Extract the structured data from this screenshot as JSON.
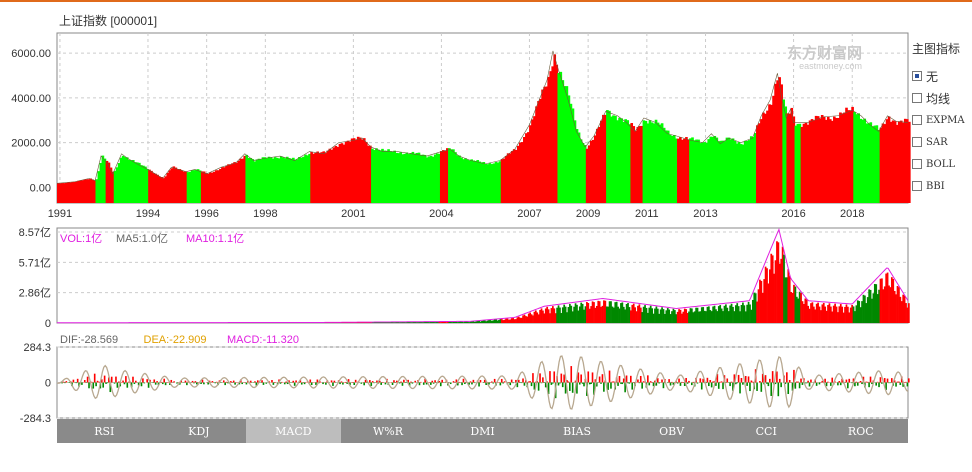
{
  "title": "上证指数 [000001]",
  "logo": {
    "name": "东方财富网",
    "sub": "eastmoney.com"
  },
  "side_panel": {
    "header": "主图指标",
    "options": [
      {
        "label": "无",
        "checked": true
      },
      {
        "label": "均线",
        "checked": false
      },
      {
        "label": "EXPMA",
        "checked": false
      },
      {
        "label": "SAR",
        "checked": false
      },
      {
        "label": "BOLL",
        "checked": false
      },
      {
        "label": "BBI",
        "checked": false
      }
    ]
  },
  "tabs": [
    {
      "label": "RSI",
      "active": false
    },
    {
      "label": "KDJ",
      "active": false
    },
    {
      "label": "MACD",
      "active": true
    },
    {
      "label": "W%R",
      "active": false
    },
    {
      "label": "DMI",
      "active": false
    },
    {
      "label": "BIAS",
      "active": false
    },
    {
      "label": "OBV",
      "active": false
    },
    {
      "label": "CCI",
      "active": false
    },
    {
      "label": "ROC",
      "active": false
    }
  ],
  "colors": {
    "up": "#ff0000",
    "down": "#00ff00",
    "grid": "#cccccc",
    "vol": "#e020e0",
    "dea": "#e0a000",
    "dif": "#666666",
    "diffline": "#b8a890"
  },
  "chart_data": [
    {
      "type": "area",
      "series_name": "price",
      "x_ticks": [
        "1991",
        "1994",
        "1996",
        "1998",
        "2001",
        "2004",
        "2007",
        "2009",
        "2011",
        "2013",
        "2016",
        "2018"
      ],
      "y_ticks": [
        "0.00",
        "2000.00",
        "4000.00",
        "6000.00"
      ],
      "ylim": [
        -700,
        6900
      ],
      "xlim": [
        1990.9,
        2019.9
      ],
      "points": [
        [
          1990.9,
          180
        ],
        [
          1991.5,
          250
        ],
        [
          1992.0,
          400
        ],
        [
          1992.2,
          300
        ],
        [
          1992.4,
          1400
        ],
        [
          1992.6,
          1100
        ],
        [
          1992.8,
          600
        ],
        [
          1993.1,
          1500
        ],
        [
          1993.3,
          1300
        ],
        [
          1993.7,
          1000
        ],
        [
          1994.0,
          800
        ],
        [
          1994.5,
          400
        ],
        [
          1994.8,
          900
        ],
        [
          1995.3,
          700
        ],
        [
          1995.6,
          800
        ],
        [
          1996.0,
          600
        ],
        [
          1996.5,
          900
        ],
        [
          1997.0,
          1100
        ],
        [
          1997.3,
          1500
        ],
        [
          1997.6,
          1200
        ],
        [
          1998.0,
          1300
        ],
        [
          1998.5,
          1400
        ],
        [
          1999.0,
          1200
        ],
        [
          1999.5,
          1600
        ],
        [
          2000.0,
          1500
        ],
        [
          2000.5,
          2000
        ],
        [
          2001.0,
          2100
        ],
        [
          2001.3,
          2200
        ],
        [
          2001.6,
          1800
        ],
        [
          2002.0,
          1600
        ],
        [
          2002.5,
          1600
        ],
        [
          2003.0,
          1500
        ],
        [
          2003.5,
          1400
        ],
        [
          2004.0,
          1600
        ],
        [
          2004.3,
          1700
        ],
        [
          2004.6,
          1400
        ],
        [
          2005.0,
          1200
        ],
        [
          2005.5,
          1050
        ],
        [
          2006.0,
          1200
        ],
        [
          2006.5,
          1700
        ],
        [
          2007.0,
          2800
        ],
        [
          2007.3,
          3800
        ],
        [
          2007.6,
          4800
        ],
        [
          2007.8,
          6100
        ],
        [
          2008.0,
          5200
        ],
        [
          2008.3,
          4000
        ],
        [
          2008.6,
          2500
        ],
        [
          2008.9,
          1800
        ],
        [
          2009.2,
          2300
        ],
        [
          2009.6,
          3400
        ],
        [
          2010.0,
          3200
        ],
        [
          2010.3,
          2900
        ],
        [
          2010.6,
          2500
        ],
        [
          2010.9,
          3100
        ],
        [
          2011.3,
          2900
        ],
        [
          2011.7,
          2400
        ],
        [
          2012.0,
          2300
        ],
        [
          2012.5,
          2100
        ],
        [
          2012.9,
          2000
        ],
        [
          2013.2,
          2400
        ],
        [
          2013.5,
          1950
        ],
        [
          2013.8,
          2200
        ],
        [
          2014.2,
          2000
        ],
        [
          2014.6,
          2200
        ],
        [
          2014.9,
          3200
        ],
        [
          2015.2,
          3900
        ],
        [
          2015.45,
          5100
        ],
        [
          2015.6,
          4000
        ],
        [
          2015.75,
          3100
        ],
        [
          2015.9,
          3500
        ],
        [
          2016.0,
          2900
        ],
        [
          2016.5,
          2900
        ],
        [
          2017.0,
          3150
        ],
        [
          2017.5,
          3200
        ],
        [
          2018.0,
          3450
        ],
        [
          2018.3,
          3200
        ],
        [
          2018.6,
          2800
        ],
        [
          2018.9,
          2500
        ],
        [
          2019.2,
          3200
        ],
        [
          2019.5,
          2950
        ],
        [
          2019.9,
          2900
        ]
      ],
      "color_segments": [
        [
          1990.9,
          1992.2,
          "up"
        ],
        [
          1992.2,
          1992.5,
          "down"
        ],
        [
          1992.5,
          1992.8,
          "up"
        ],
        [
          1992.8,
          1994.0,
          "down"
        ],
        [
          1994.0,
          1995.3,
          "up"
        ],
        [
          1995.3,
          1995.8,
          "down"
        ],
        [
          1995.8,
          1997.3,
          "up"
        ],
        [
          1997.3,
          1999.5,
          "down"
        ],
        [
          1999.5,
          2001.6,
          "up"
        ],
        [
          2001.6,
          2003.9,
          "down"
        ],
        [
          2003.9,
          2004.2,
          "up"
        ],
        [
          2004.2,
          2006.0,
          "down"
        ],
        [
          2006.0,
          2007.9,
          "up"
        ],
        [
          2007.9,
          2008.9,
          "down"
        ],
        [
          2008.9,
          2009.6,
          "up"
        ],
        [
          2009.6,
          2010.4,
          "down"
        ],
        [
          2010.4,
          2010.8,
          "up"
        ],
        [
          2010.8,
          2012.0,
          "down"
        ],
        [
          2012.0,
          2012.4,
          "up"
        ],
        [
          2012.4,
          2014.7,
          "down"
        ],
        [
          2014.7,
          2015.6,
          "up"
        ],
        [
          2015.6,
          2015.75,
          "down"
        ],
        [
          2015.75,
          2016.0,
          "up"
        ],
        [
          2016.0,
          2016.2,
          "down"
        ],
        [
          2016.2,
          2018.0,
          "up"
        ],
        [
          2018.0,
          2018.9,
          "down"
        ],
        [
          2018.9,
          2019.9,
          "up"
        ]
      ]
    },
    {
      "type": "bar",
      "series_name": "VOL",
      "legend": [
        {
          "text": "VOL:1亿",
          "color": "vol"
        },
        {
          "text": "MA5:1.0亿",
          "color": "dif"
        },
        {
          "text": "MA10:1.1亿",
          "color": "vol"
        }
      ],
      "y_ticks": [
        "0",
        "2.86亿",
        "5.71亿",
        "8.57亿"
      ],
      "ylim": [
        0,
        8.57
      ],
      "profile": [
        [
          1990.9,
          0.02
        ],
        [
          2000,
          0.05
        ],
        [
          2005,
          0.15
        ],
        [
          2006.5,
          0.5
        ],
        [
          2007.5,
          1.5
        ],
        [
          2009.5,
          2.2
        ],
        [
          2012,
          1.3
        ],
        [
          2014.5,
          2.0
        ],
        [
          2015.2,
          6.5
        ],
        [
          2015.5,
          8.4
        ],
        [
          2015.9,
          4.0
        ],
        [
          2016.5,
          2.0
        ],
        [
          2018,
          1.7
        ],
        [
          2019.2,
          5.0
        ],
        [
          2019.9,
          2.0
        ]
      ]
    },
    {
      "type": "bar",
      "series_name": "MACD",
      "legend": [
        {
          "text": "DIF:-28.569",
          "color": "dif"
        },
        {
          "text": "DEA:-22.909",
          "color": "dea"
        },
        {
          "text": "MACD:-11.320",
          "color": "vol"
        }
      ],
      "y_ticks": [
        "284.3",
        "0",
        "-284.3"
      ],
      "ylim": [
        -284.3,
        284.3
      ],
      "profile": [
        [
          1990.9,
          5
        ],
        [
          1992.4,
          160
        ],
        [
          1993.1,
          110
        ],
        [
          1995,
          40
        ],
        [
          2000,
          50
        ],
        [
          2006.5,
          60
        ],
        [
          2007.8,
          240
        ],
        [
          2008.6,
          240
        ],
        [
          2009.6,
          180
        ],
        [
          2012,
          60
        ],
        [
          2015.4,
          230
        ],
        [
          2015.8,
          230
        ],
        [
          2016.5,
          60
        ],
        [
          2019.2,
          110
        ],
        [
          2019.9,
          80
        ]
      ]
    }
  ]
}
